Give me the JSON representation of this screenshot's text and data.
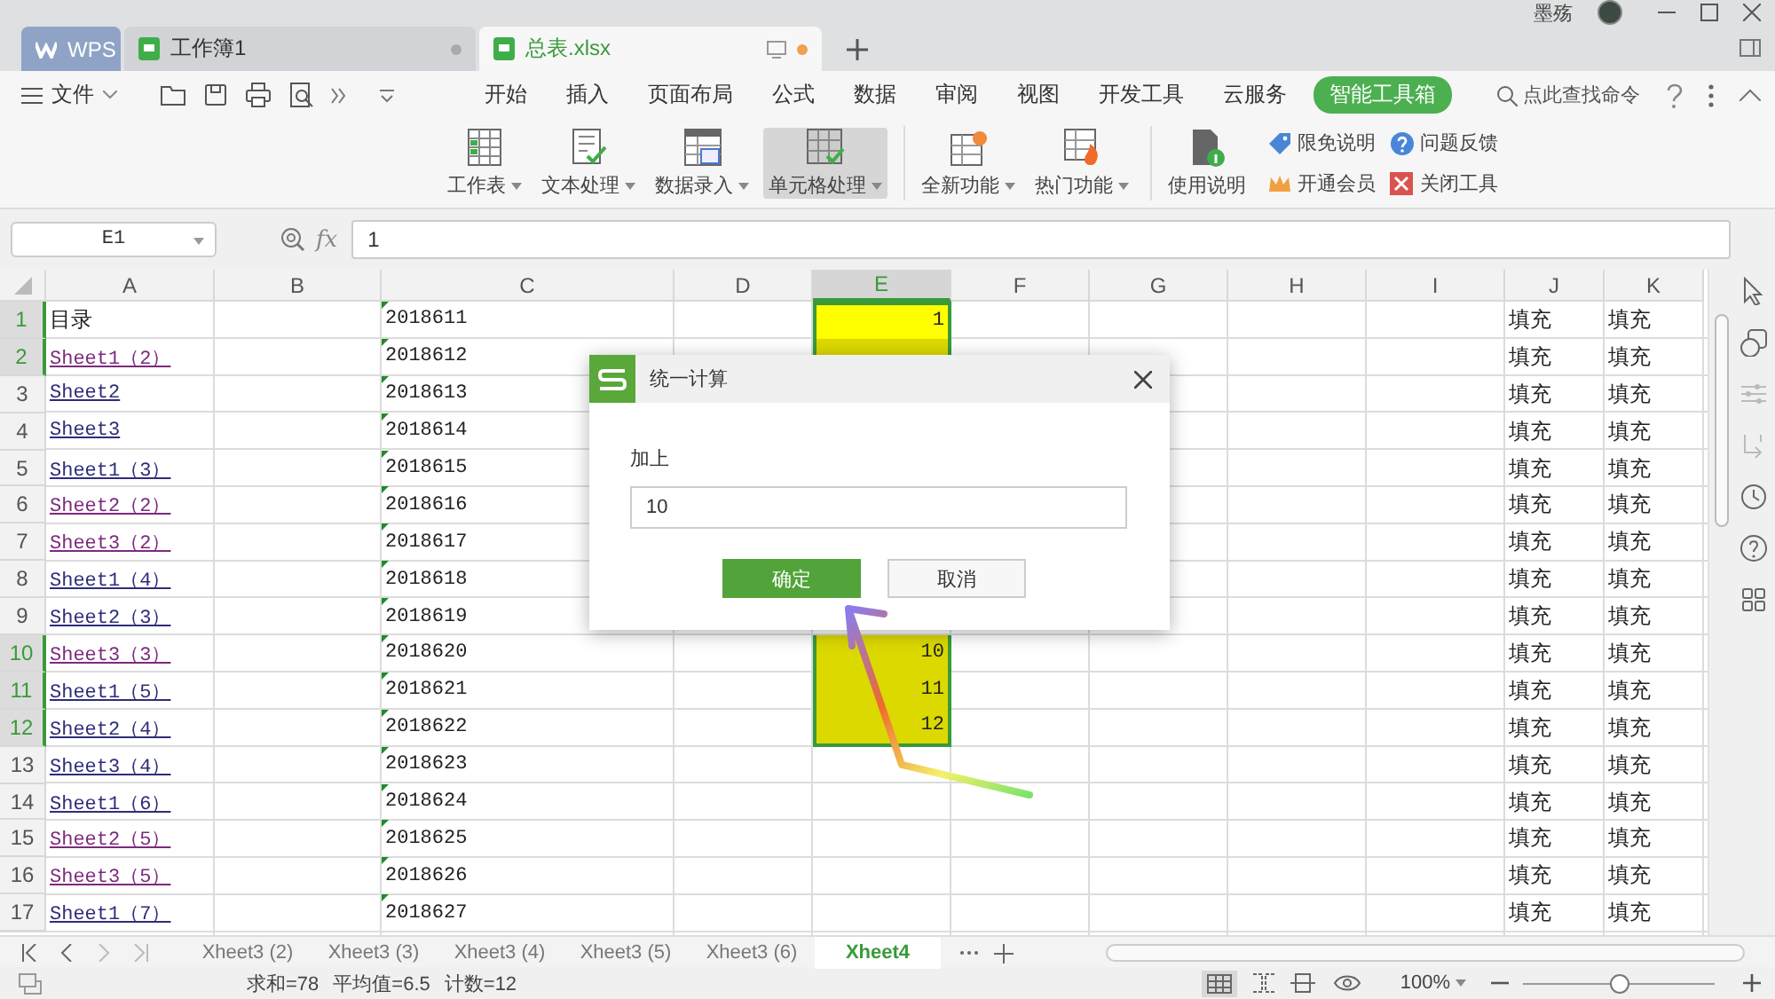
{
  "title_tabs": [
    {
      "label": "WPS",
      "kind": "brand",
      "selected": false
    },
    {
      "label": "工作簿1",
      "kind": "doc",
      "selected": false,
      "modified": false
    },
    {
      "label": "总表.xlsx",
      "kind": "doc",
      "selected": true,
      "modified": true
    }
  ],
  "user": {
    "name": "墨殇"
  },
  "menu": {
    "file": "文件",
    "tabs": [
      {
        "label": "开始",
        "selected": false
      },
      {
        "label": "插入",
        "selected": false
      },
      {
        "label": "页面布局",
        "selected": false
      },
      {
        "label": "公式",
        "selected": false
      },
      {
        "label": "数据",
        "selected": false
      },
      {
        "label": "审阅",
        "selected": false
      },
      {
        "label": "视图",
        "selected": false
      },
      {
        "label": "开发工具",
        "selected": false
      },
      {
        "label": "云服务",
        "selected": false
      },
      {
        "label": "智能工具箱",
        "selected": true
      }
    ],
    "search": "点此查找命令"
  },
  "ribbon": {
    "groups": [
      [
        {
          "label": "工作表",
          "kind": "large",
          "pressed": false
        },
        {
          "label": "文本处理",
          "kind": "large",
          "pressed": false
        },
        {
          "label": "数据录入",
          "kind": "large",
          "pressed": false
        },
        {
          "label": "单元格处理",
          "kind": "large",
          "pressed": true
        }
      ],
      [
        {
          "label": "全新功能",
          "kind": "large",
          "pressed": false
        },
        {
          "label": "热门功能",
          "kind": "large",
          "pressed": false
        }
      ],
      [
        {
          "label": "使用说明",
          "kind": "plain",
          "pressed": false
        },
        {
          "label": "限免说明",
          "kind": "small",
          "pressed": false
        },
        {
          "label": "开通会员",
          "kind": "small",
          "pressed": false
        },
        {
          "label": "问题反馈",
          "kind": "small",
          "pressed": false
        },
        {
          "label": "关闭工具",
          "kind": "small",
          "pressed": false
        }
      ]
    ]
  },
  "formula_bar": {
    "name_box": "E1",
    "fx": "fx",
    "value": "1"
  },
  "columns": [
    {
      "label": "A",
      "selected": false
    },
    {
      "label": "B",
      "selected": false
    },
    {
      "label": "C",
      "selected": false
    },
    {
      "label": "D",
      "selected": false
    },
    {
      "label": "E",
      "selected": true
    },
    {
      "label": "F",
      "selected": false
    },
    {
      "label": "G",
      "selected": false
    },
    {
      "label": "H",
      "selected": false
    },
    {
      "label": "I",
      "selected": false
    },
    {
      "label": "J",
      "selected": false
    },
    {
      "label": "K",
      "selected": false
    }
  ],
  "rows": [
    {
      "number": "1",
      "a": {
        "text": "目录",
        "kind": "text"
      },
      "c": "2018611",
      "e": {
        "text": "1",
        "selected": true,
        "active": true
      },
      "j": "填充",
      "k": "填充"
    },
    {
      "number": "2",
      "a": {
        "text": "Sheet1（2）",
        "kind": "link",
        "visited": true
      },
      "c": "2018612",
      "e": {
        "selected": true,
        "active": false
      },
      "j": "填充",
      "k": "填充"
    },
    {
      "number": "3",
      "a": {
        "text": "Sheet2",
        "kind": "link",
        "visited": false
      },
      "c": "2018613",
      "j": "填充",
      "k": "填充"
    },
    {
      "number": "4",
      "a": {
        "text": "Sheet3",
        "kind": "link",
        "visited": false
      },
      "c": "2018614",
      "j": "填充",
      "k": "填充"
    },
    {
      "number": "5",
      "a": {
        "text": "Sheet1（3）",
        "kind": "link",
        "visited": false
      },
      "c": "2018615",
      "j": "填充",
      "k": "填充"
    },
    {
      "number": "6",
      "a": {
        "text": "Sheet2（2）",
        "kind": "link",
        "visited": true
      },
      "c": "2018616",
      "j": "填充",
      "k": "填充"
    },
    {
      "number": "7",
      "a": {
        "text": "Sheet3（2）",
        "kind": "link",
        "visited": true
      },
      "c": "2018617",
      "j": "填充",
      "k": "填充"
    },
    {
      "number": "8",
      "a": {
        "text": "Sheet1（4）",
        "kind": "link",
        "visited": false
      },
      "c": "2018618",
      "j": "填充",
      "k": "填充"
    },
    {
      "number": "9",
      "a": {
        "text": "Sheet2（3）",
        "kind": "link",
        "visited": false
      },
      "c": "2018619",
      "j": "填充",
      "k": "填充"
    },
    {
      "number": "10",
      "a": {
        "text": "Sheet3（3）",
        "kind": "link",
        "visited": true
      },
      "c": "2018620",
      "e": {
        "text": "10",
        "selected": true,
        "active": false
      },
      "j": "填充",
      "k": "填充"
    },
    {
      "number": "11",
      "a": {
        "text": "Sheet1（5）",
        "kind": "link",
        "visited": false
      },
      "c": "2018621",
      "e": {
        "text": "11",
        "selected": true,
        "active": false
      },
      "j": "填充",
      "k": "填充"
    },
    {
      "number": "12",
      "a": {
        "text": "Sheet2（4）",
        "kind": "link",
        "visited": false
      },
      "c": "2018622",
      "e": {
        "text": "12",
        "selected": true,
        "active": false
      },
      "j": "填充",
      "k": "填充"
    },
    {
      "number": "13",
      "a": {
        "text": "Sheet3（4）",
        "kind": "link",
        "visited": false
      },
      "c": "2018623",
      "j": "填充",
      "k": "填充"
    },
    {
      "number": "14",
      "a": {
        "text": "Sheet1（6）",
        "kind": "link",
        "visited": false
      },
      "c": "2018624",
      "j": "填充",
      "k": "填充"
    },
    {
      "number": "15",
      "a": {
        "text": "Sheet2（5）",
        "kind": "link",
        "visited": true
      },
      "c": "2018625",
      "j": "填充",
      "k": "填充"
    },
    {
      "number": "16",
      "a": {
        "text": "Sheet3（5）",
        "kind": "link",
        "visited": true
      },
      "c": "2018626",
      "j": "填充",
      "k": "填充"
    },
    {
      "number": "17",
      "a": {
        "text": "Sheet1（7）",
        "kind": "link",
        "visited": false
      },
      "c": "2018627",
      "j": "填充",
      "k": "填充"
    }
  ],
  "dialog": {
    "title": "统一计算",
    "label": "加上",
    "value": "10",
    "ok": "确定",
    "cancel": "取消"
  },
  "sheet_tabs": [
    {
      "label": "Xheet3 (2)",
      "selected": false
    },
    {
      "label": "Xheet3 (3)",
      "selected": false
    },
    {
      "label": "Xheet3 (4)",
      "selected": false
    },
    {
      "label": "Xheet3 (5)",
      "selected": false
    },
    {
      "label": "Xheet3 (6)",
      "selected": false
    },
    {
      "label": "Xheet4",
      "selected": true
    }
  ],
  "status_bar": {
    "summary": [
      "求和=78",
      "平均值=6.5",
      "计数=12"
    ],
    "zoom": "100%",
    "zoom_slider": {
      "level": 0.5
    }
  }
}
